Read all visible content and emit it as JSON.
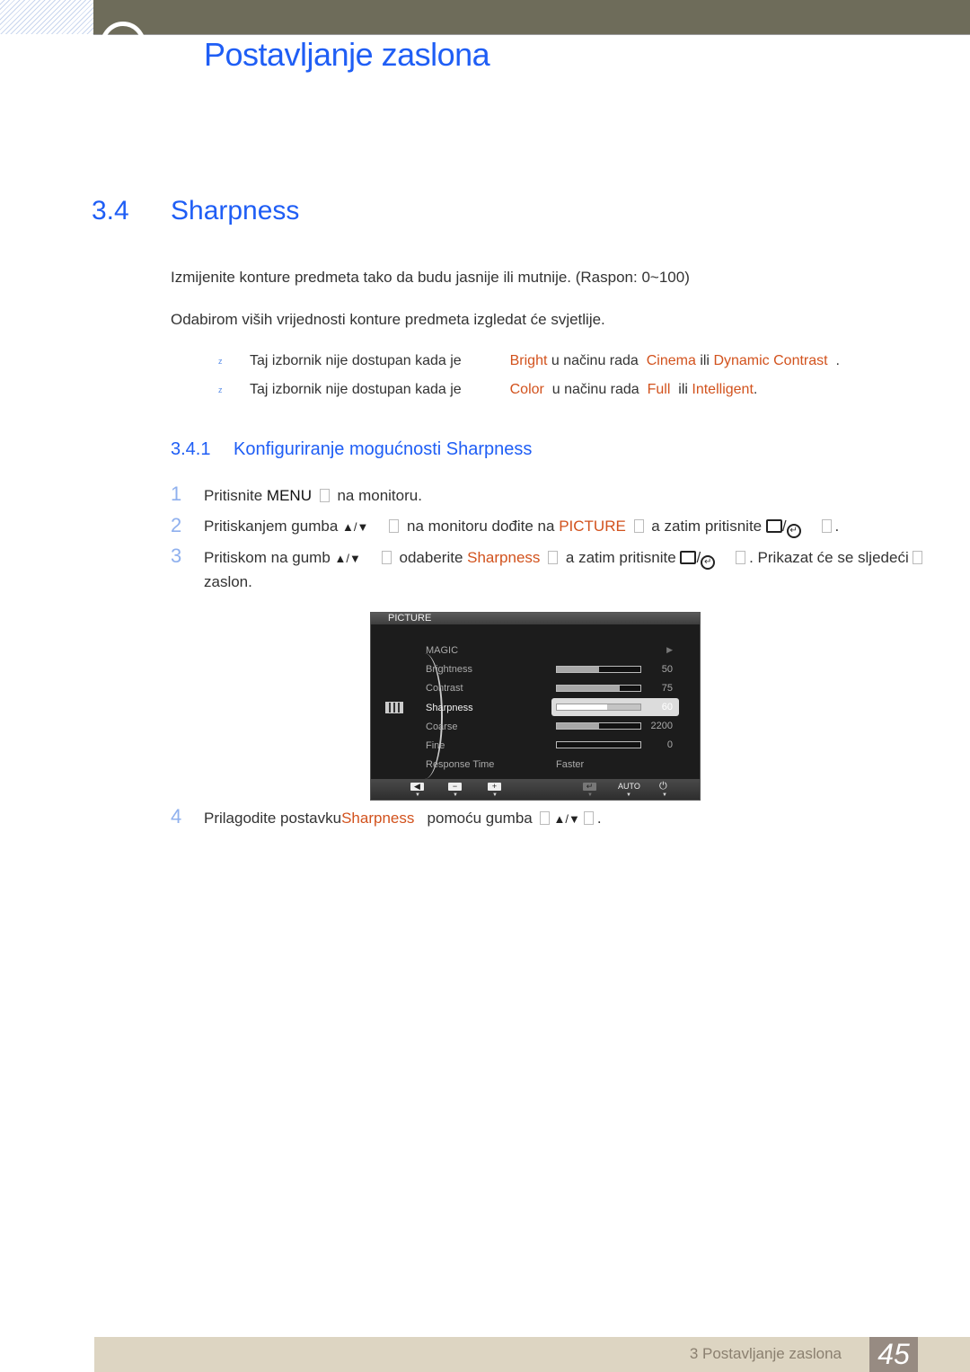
{
  "header": {
    "chapter_title": "Postavljanje zaslona"
  },
  "section": {
    "number": "3.4",
    "title": "Sharpness"
  },
  "intro": {
    "p1": "Izmijenite konture predmeta tako da budu jasnije ili mutnije. (Raspon: 0~100)",
    "p2": "Odabirom viših vrijednosti konture predmeta izgledat će svjetlije."
  },
  "notes": [
    {
      "bullet": "z",
      "pre": "Taj izbornik nije dostupan kada je",
      "k1": "Bright",
      "mid": "u načinu rada",
      "k2": "Cinema",
      "or": "ili",
      "k3": "Dynamic Contrast",
      "end": "."
    },
    {
      "bullet": "z",
      "pre": "Taj izbornik nije dostupan kada je",
      "k1": "Color",
      "mid": "u načinu rada",
      "k2": "Full",
      "or": "ili",
      "k3": "Intelligent",
      "end": "."
    }
  ],
  "subsection": {
    "number": "3.4.1",
    "title": "Konfiguriranje mogućnosti Sharpness"
  },
  "steps": [
    {
      "num": "1",
      "a": "Pritisnite",
      "key": "MENU",
      "b": "na monitoru."
    },
    {
      "num": "2",
      "a": "Pritiskanjem gumba",
      "keys": "▲/▼",
      "b": "na monitoru dođite na",
      "hl": "PICTURE",
      "c": "a zatim pritisnite",
      "d": "."
    },
    {
      "num": "3",
      "a": "Pritiskom na gumb",
      "keys": "▲/▼",
      "b": "odaberite",
      "hl": "Sharpness",
      "c": "a zatim pritisnite",
      "d": ". Prikazat će se sljedeći",
      "e": "zaslon."
    },
    {
      "num": "4",
      "a": "Prilagodite postavku",
      "hl": "Sharpness",
      "b": "pomoću gumba",
      "keys": "▲/▼",
      "d": "."
    }
  ],
  "osd": {
    "title": "PICTURE",
    "items": [
      {
        "label": "MAGIC",
        "value": "▶"
      },
      {
        "label": "Brightness",
        "value": "50",
        "level": 0.5
      },
      {
        "label": "Contrast",
        "value": "75",
        "level": 0.75
      },
      {
        "label": "Sharpness",
        "value": "60",
        "level": 0.6,
        "active": true
      },
      {
        "label": "Coarse",
        "value": "2200",
        "level": 0.5
      },
      {
        "label": "Fine",
        "value": "0",
        "level": 0
      },
      {
        "label": "Response Time",
        "value": "Faster"
      }
    ],
    "buttons": {
      "left": "◀",
      "minus": "−",
      "plus": "+",
      "enter": "↵",
      "auto": "AUTO",
      "power": "⏻",
      "arrow": "▼"
    }
  },
  "footer": {
    "text": "3 Postavljanje zaslona",
    "page": "45"
  }
}
